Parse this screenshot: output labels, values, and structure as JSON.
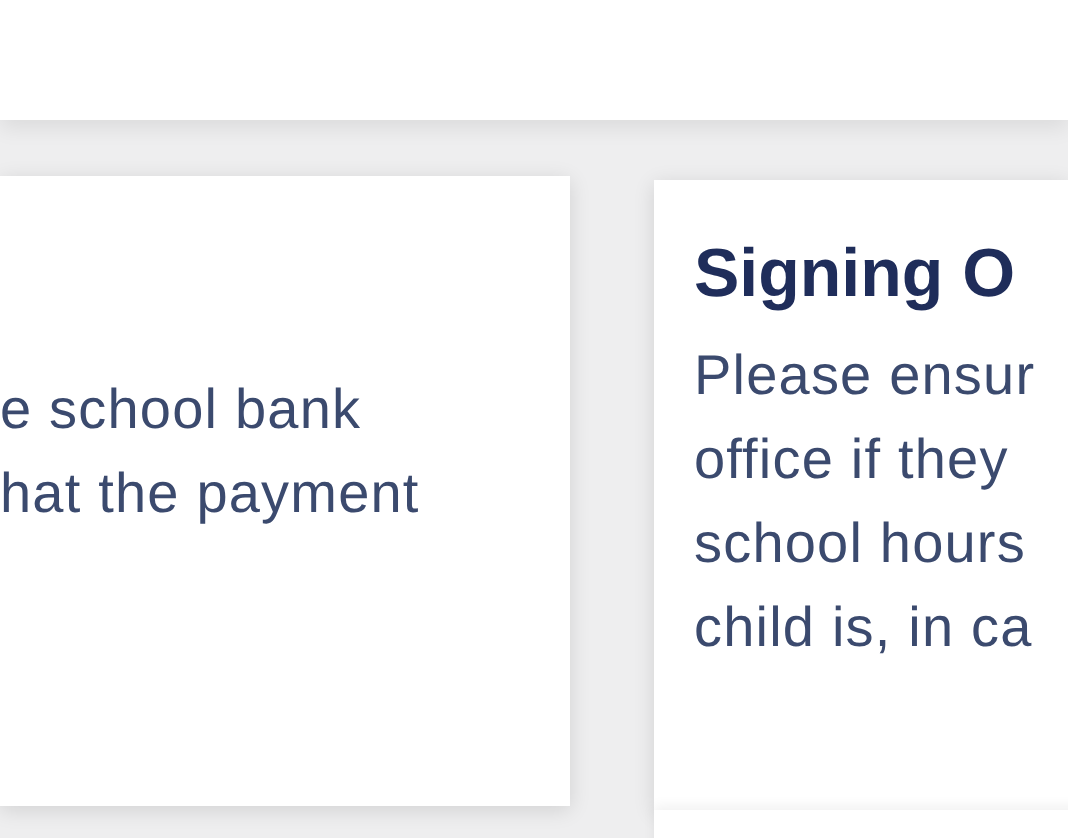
{
  "cards": [
    {
      "lines": [
        "e school bank",
        "hat the payment"
      ]
    },
    {
      "title": "Signing O",
      "lines": [
        "Please ensur",
        "office if they",
        "school hours",
        "child is, in ca"
      ]
    }
  ]
}
